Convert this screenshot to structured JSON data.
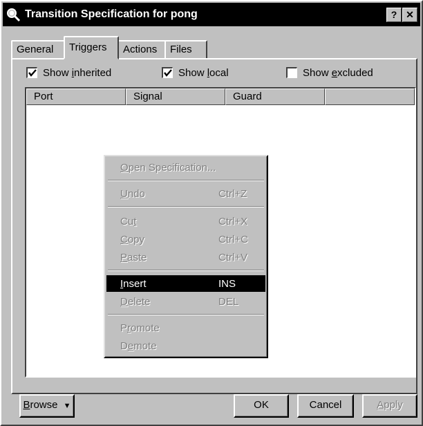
{
  "window": {
    "title": "Transition Specification for pong",
    "help_button": "?",
    "close_button": "✕"
  },
  "tabs": [
    {
      "label": "General",
      "active": false
    },
    {
      "label": "Triggers",
      "active": true
    },
    {
      "label": "Actions",
      "active": false
    },
    {
      "label": "Files",
      "active": false
    }
  ],
  "checkboxes": [
    {
      "pre": "Show ",
      "accel": "i",
      "post": "nherited",
      "checked": true
    },
    {
      "pre": "Show ",
      "accel": "l",
      "post": "ocal",
      "checked": true
    },
    {
      "pre": "Show ",
      "accel": "e",
      "post": "xcluded",
      "checked": false
    }
  ],
  "list": {
    "columns": [
      "Port",
      "Signal",
      "Guard",
      ""
    ],
    "rows": []
  },
  "context_menu": {
    "items": [
      {
        "accel": "O",
        "rest": "pen Specification...",
        "shortcut": "",
        "enabled": false
      },
      {
        "accel": "U",
        "rest": "ndo",
        "shortcut": "Ctrl+Z",
        "enabled": false
      },
      {
        "pre": "Cu",
        "accel": "t",
        "rest": "",
        "shortcut": "Ctrl+X",
        "enabled": false
      },
      {
        "accel": "C",
        "rest": "opy",
        "shortcut": "Ctrl+C",
        "enabled": false
      },
      {
        "accel": "P",
        "rest": "aste",
        "shortcut": "Ctrl+V",
        "enabled": false
      },
      {
        "accel": "I",
        "rest": "nsert",
        "shortcut": "INS",
        "enabled": true,
        "selected": true
      },
      {
        "accel": "D",
        "rest": "elete",
        "shortcut": "DEL",
        "enabled": false
      },
      {
        "pre": "P",
        "accel": "r",
        "rest": "omote",
        "shortcut": "",
        "enabled": false
      },
      {
        "pre": "D",
        "accel": "e",
        "rest": "mote",
        "shortcut": "",
        "enabled": false
      }
    ]
  },
  "buttons": {
    "browse": {
      "accel": "B",
      "rest": "rowse",
      "arrow": "▼"
    },
    "ok": "OK",
    "cancel": "Cancel",
    "apply": {
      "accel": "A",
      "rest": "pply",
      "enabled": false
    }
  },
  "colors": {
    "face": "#c0c0c0",
    "titlebar": "#000000",
    "highlight": "#000000",
    "disabled_text": "#808080"
  }
}
